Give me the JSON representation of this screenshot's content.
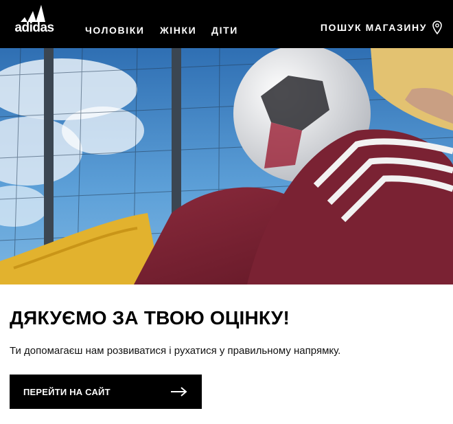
{
  "header": {
    "logo_text": "adidas",
    "nav": [
      {
        "label": "ЧОЛОВІКИ"
      },
      {
        "label": "ЖІНКИ"
      },
      {
        "label": "ДІТИ"
      }
    ],
    "store_locator": {
      "label": "ПОШУК МАГАЗИНУ",
      "icon": "map-pin-icon"
    }
  },
  "hero": {
    "description": "Football player in burgundy three-stripe tracksuit holding a soccer ball against blue sky and fence"
  },
  "message": {
    "title": "ДЯКУЄМО ЗА ТВОЮ ОЦІНКУ!",
    "subtitle": "Ти допомагаєш нам розвиватися і рухатися у правильному напрямку."
  },
  "cta": {
    "label": "ПЕРЕЙТИ НА САЙТ",
    "icon": "arrow-right-icon"
  },
  "colors": {
    "header_bg": "#000000",
    "button_bg": "#000000",
    "text": "#000000"
  }
}
